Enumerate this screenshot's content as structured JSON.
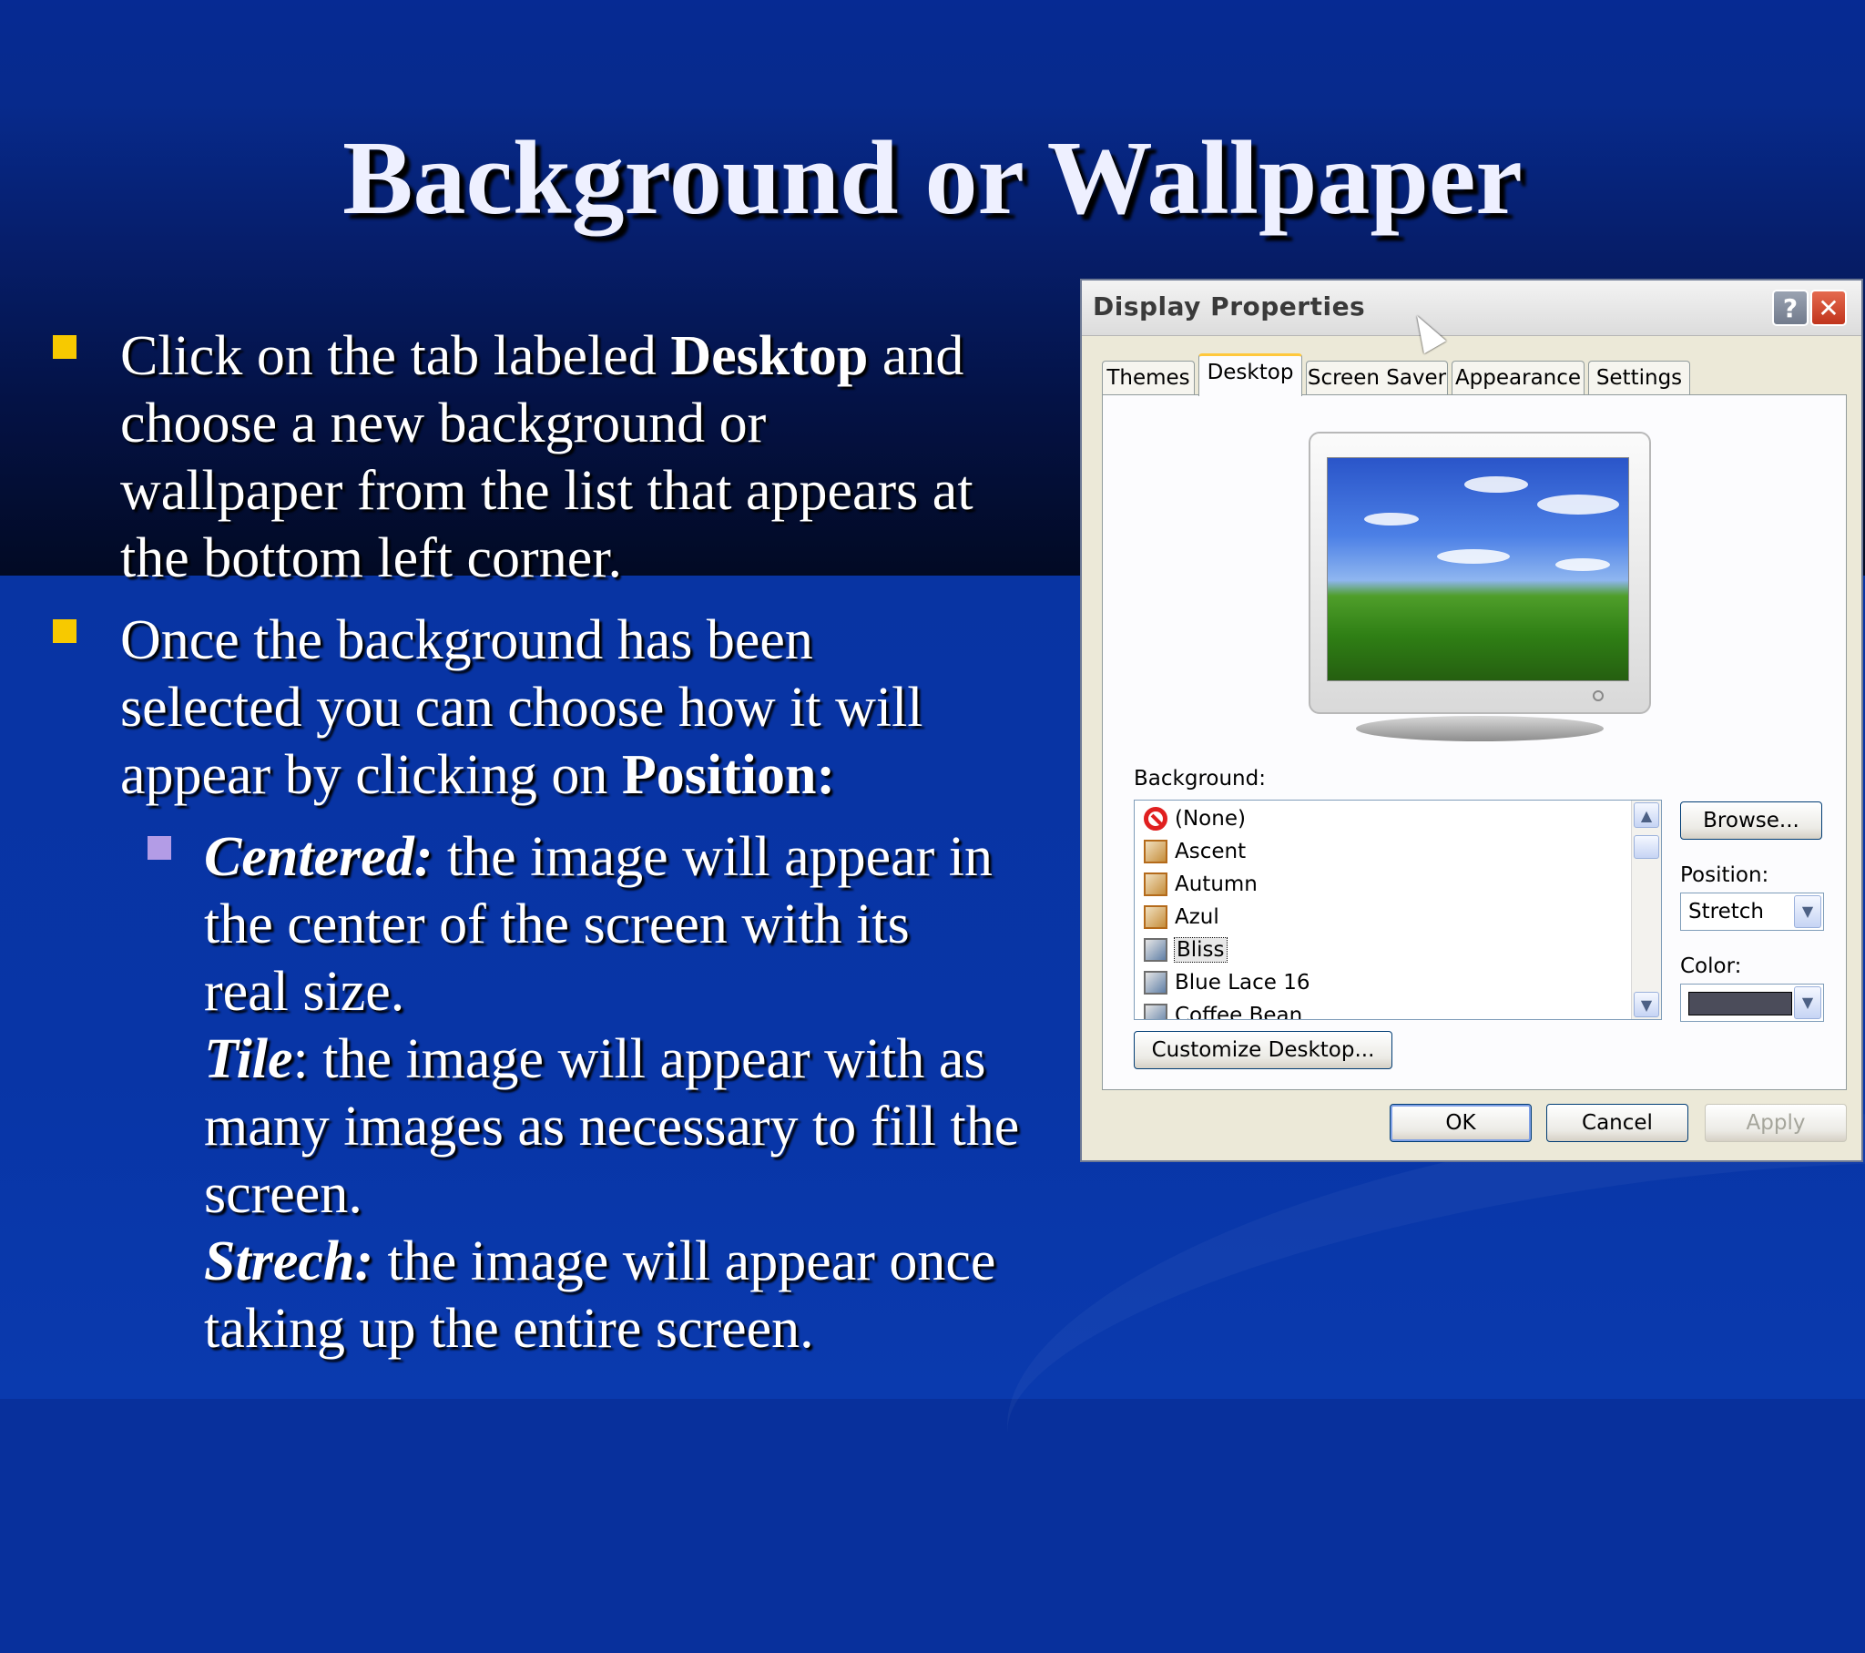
{
  "slide": {
    "title": "Background or Wallpaper",
    "bullets": [
      {
        "pre": "Click on the tab labeled ",
        "bold": "Desktop",
        "post_line1": " and",
        "line2": "choose a new background or",
        "line3": "wallpaper from the list that appears at",
        "line4": "the bottom left corner."
      },
      {
        "line1": "Once the background has been",
        "line2": "selected you can choose how it will",
        "line3_pre": "appear by clicking on ",
        "line3_bold": "Position:"
      }
    ],
    "sub": {
      "centered_term": "Centered:",
      "centered_l1": " the image will appear in",
      "centered_l2": "the center of the screen with its",
      "centered_l3": "real size.",
      "tile_term": "Tile",
      "tile_l1": ": the image will appear with as",
      "tile_l2": "many images as necessary to fill the",
      "tile_l3": "screen.",
      "stretch_term": "Strech:",
      "stretch_l1": " the image will appear once",
      "stretch_l2": "taking up the entire screen."
    },
    "colors": {
      "bullet": "#f7c900",
      "sub_bullet": "#b39ce6",
      "background": "#08309c"
    }
  },
  "dialog": {
    "title": "Display Properties",
    "help_label": "?",
    "close_label": "✕",
    "tabs": [
      "Themes",
      "Desktop",
      "Screen Saver",
      "Appearance",
      "Settings"
    ],
    "active_tab": "Desktop",
    "background_label": "Background:",
    "list_items": [
      {
        "label": "(None)",
        "icon": "none-icon"
      },
      {
        "label": "Ascent",
        "icon": "image-icon"
      },
      {
        "label": "Autumn",
        "icon": "image-icon"
      },
      {
        "label": "Azul",
        "icon": "image-icon"
      },
      {
        "label": "Bliss",
        "icon": "bitmap-icon",
        "selected": true
      },
      {
        "label": "Blue Lace 16",
        "icon": "bitmap-icon"
      },
      {
        "label": "Coffee Bean",
        "icon": "bitmap-icon"
      }
    ],
    "browse_label": "Browse...",
    "position_label": "Position:",
    "position_value": "Stretch",
    "color_label": "Color:",
    "color_value": "#4b4c5a",
    "customize_label": "Customize Desktop...",
    "ok_label": "OK",
    "cancel_label": "Cancel",
    "apply_label": "Apply"
  }
}
